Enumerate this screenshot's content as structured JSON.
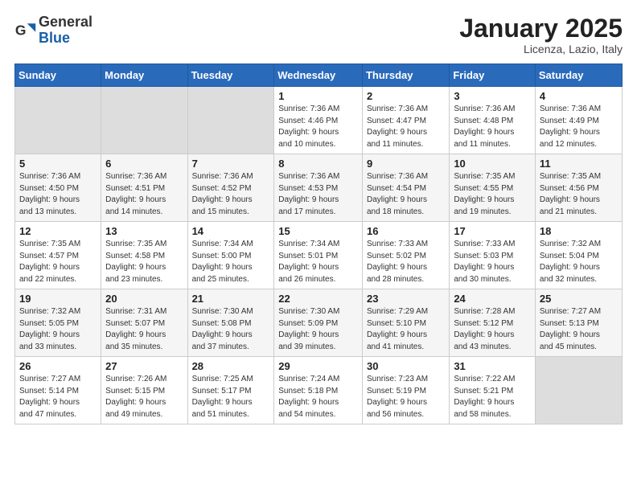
{
  "logo": {
    "general": "General",
    "blue": "Blue"
  },
  "header": {
    "month": "January 2025",
    "location": "Licenza, Lazio, Italy"
  },
  "weekdays": [
    "Sunday",
    "Monday",
    "Tuesday",
    "Wednesday",
    "Thursday",
    "Friday",
    "Saturday"
  ],
  "weeks": [
    [
      {
        "day": "",
        "info": ""
      },
      {
        "day": "",
        "info": ""
      },
      {
        "day": "",
        "info": ""
      },
      {
        "day": "1",
        "info": "Sunrise: 7:36 AM\nSunset: 4:46 PM\nDaylight: 9 hours\nand 10 minutes."
      },
      {
        "day": "2",
        "info": "Sunrise: 7:36 AM\nSunset: 4:47 PM\nDaylight: 9 hours\nand 11 minutes."
      },
      {
        "day": "3",
        "info": "Sunrise: 7:36 AM\nSunset: 4:48 PM\nDaylight: 9 hours\nand 11 minutes."
      },
      {
        "day": "4",
        "info": "Sunrise: 7:36 AM\nSunset: 4:49 PM\nDaylight: 9 hours\nand 12 minutes."
      }
    ],
    [
      {
        "day": "5",
        "info": "Sunrise: 7:36 AM\nSunset: 4:50 PM\nDaylight: 9 hours\nand 13 minutes."
      },
      {
        "day": "6",
        "info": "Sunrise: 7:36 AM\nSunset: 4:51 PM\nDaylight: 9 hours\nand 14 minutes."
      },
      {
        "day": "7",
        "info": "Sunrise: 7:36 AM\nSunset: 4:52 PM\nDaylight: 9 hours\nand 15 minutes."
      },
      {
        "day": "8",
        "info": "Sunrise: 7:36 AM\nSunset: 4:53 PM\nDaylight: 9 hours\nand 17 minutes."
      },
      {
        "day": "9",
        "info": "Sunrise: 7:36 AM\nSunset: 4:54 PM\nDaylight: 9 hours\nand 18 minutes."
      },
      {
        "day": "10",
        "info": "Sunrise: 7:35 AM\nSunset: 4:55 PM\nDaylight: 9 hours\nand 19 minutes."
      },
      {
        "day": "11",
        "info": "Sunrise: 7:35 AM\nSunset: 4:56 PM\nDaylight: 9 hours\nand 21 minutes."
      }
    ],
    [
      {
        "day": "12",
        "info": "Sunrise: 7:35 AM\nSunset: 4:57 PM\nDaylight: 9 hours\nand 22 minutes."
      },
      {
        "day": "13",
        "info": "Sunrise: 7:35 AM\nSunset: 4:58 PM\nDaylight: 9 hours\nand 23 minutes."
      },
      {
        "day": "14",
        "info": "Sunrise: 7:34 AM\nSunset: 5:00 PM\nDaylight: 9 hours\nand 25 minutes."
      },
      {
        "day": "15",
        "info": "Sunrise: 7:34 AM\nSunset: 5:01 PM\nDaylight: 9 hours\nand 26 minutes."
      },
      {
        "day": "16",
        "info": "Sunrise: 7:33 AM\nSunset: 5:02 PM\nDaylight: 9 hours\nand 28 minutes."
      },
      {
        "day": "17",
        "info": "Sunrise: 7:33 AM\nSunset: 5:03 PM\nDaylight: 9 hours\nand 30 minutes."
      },
      {
        "day": "18",
        "info": "Sunrise: 7:32 AM\nSunset: 5:04 PM\nDaylight: 9 hours\nand 32 minutes."
      }
    ],
    [
      {
        "day": "19",
        "info": "Sunrise: 7:32 AM\nSunset: 5:05 PM\nDaylight: 9 hours\nand 33 minutes."
      },
      {
        "day": "20",
        "info": "Sunrise: 7:31 AM\nSunset: 5:07 PM\nDaylight: 9 hours\nand 35 minutes."
      },
      {
        "day": "21",
        "info": "Sunrise: 7:30 AM\nSunset: 5:08 PM\nDaylight: 9 hours\nand 37 minutes."
      },
      {
        "day": "22",
        "info": "Sunrise: 7:30 AM\nSunset: 5:09 PM\nDaylight: 9 hours\nand 39 minutes."
      },
      {
        "day": "23",
        "info": "Sunrise: 7:29 AM\nSunset: 5:10 PM\nDaylight: 9 hours\nand 41 minutes."
      },
      {
        "day": "24",
        "info": "Sunrise: 7:28 AM\nSunset: 5:12 PM\nDaylight: 9 hours\nand 43 minutes."
      },
      {
        "day": "25",
        "info": "Sunrise: 7:27 AM\nSunset: 5:13 PM\nDaylight: 9 hours\nand 45 minutes."
      }
    ],
    [
      {
        "day": "26",
        "info": "Sunrise: 7:27 AM\nSunset: 5:14 PM\nDaylight: 9 hours\nand 47 minutes."
      },
      {
        "day": "27",
        "info": "Sunrise: 7:26 AM\nSunset: 5:15 PM\nDaylight: 9 hours\nand 49 minutes."
      },
      {
        "day": "28",
        "info": "Sunrise: 7:25 AM\nSunset: 5:17 PM\nDaylight: 9 hours\nand 51 minutes."
      },
      {
        "day": "29",
        "info": "Sunrise: 7:24 AM\nSunset: 5:18 PM\nDaylight: 9 hours\nand 54 minutes."
      },
      {
        "day": "30",
        "info": "Sunrise: 7:23 AM\nSunset: 5:19 PM\nDaylight: 9 hours\nand 56 minutes."
      },
      {
        "day": "31",
        "info": "Sunrise: 7:22 AM\nSunset: 5:21 PM\nDaylight: 9 hours\nand 58 minutes."
      },
      {
        "day": "",
        "info": ""
      }
    ]
  ]
}
